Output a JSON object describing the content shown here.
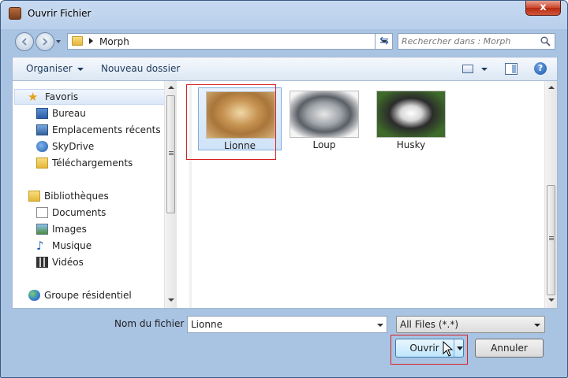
{
  "window": {
    "title": "Ouvrir Fichier",
    "close_label": "x"
  },
  "address": {
    "path": "Morph"
  },
  "search": {
    "placeholder": "Rechercher dans : Morph"
  },
  "toolbar": {
    "organise_label": "Organiser",
    "new_folder_label": "Nouveau dossier"
  },
  "nav": {
    "favorites_label": "Favoris",
    "favorites": [
      "Bureau",
      "Emplacements récents",
      "SkyDrive",
      "Téléchargements"
    ],
    "libraries_label": "Bibliothèques",
    "libraries": [
      "Documents",
      "Images",
      "Musique",
      "Vidéos"
    ],
    "homegroup_label": "Groupe résidentiel"
  },
  "files": [
    {
      "name": "Lionne",
      "selected": true
    },
    {
      "name": "Loup",
      "selected": false
    },
    {
      "name": "Husky",
      "selected": false
    }
  ],
  "footer": {
    "filename_label": "Nom du fichier :",
    "filename_value": "Lionne",
    "filetype_value": "All Files (*.*)",
    "open_label": "Ouvrir",
    "cancel_label": "Annuler"
  }
}
